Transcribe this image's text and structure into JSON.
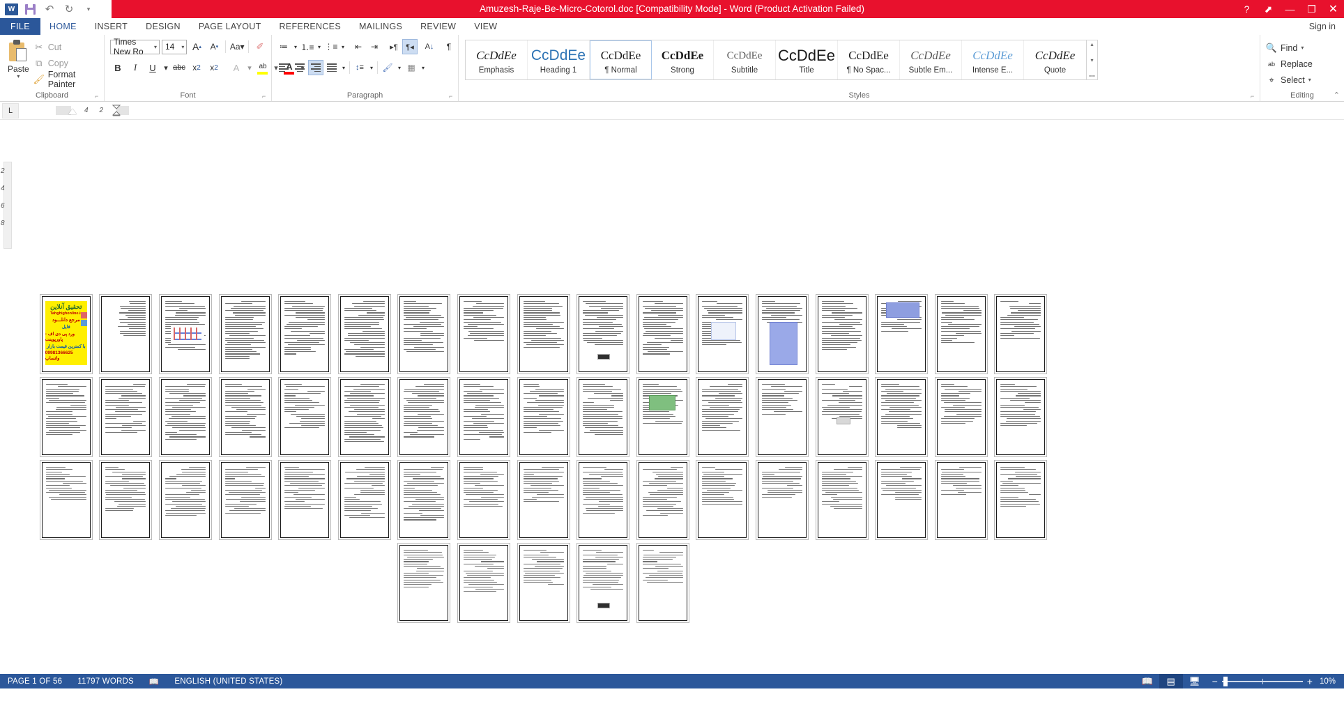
{
  "titlebar": {
    "document_title": "Amuzesh-Raje-Be-Micro-Cotorol.doc [Compatibility Mode]  -  Word (Product Activation Failed)",
    "quick_access": [
      {
        "name": "word-logo",
        "label": "W"
      },
      {
        "name": "save-icon",
        "label": ""
      },
      {
        "name": "undo-icon",
        "label": "↶"
      },
      {
        "name": "redo-icon",
        "label": "↻"
      },
      {
        "name": "customize-qat-icon",
        "label": "▾"
      }
    ],
    "window_buttons": [
      {
        "name": "help-button",
        "label": "?"
      },
      {
        "name": "ribbon-display-options-button",
        "label": "⬈"
      },
      {
        "name": "minimize-button",
        "label": "—"
      },
      {
        "name": "restore-button",
        "label": "❐"
      },
      {
        "name": "close-button",
        "label": "✕"
      }
    ]
  },
  "tabs": {
    "file": "FILE",
    "items": [
      "HOME",
      "INSERT",
      "DESIGN",
      "PAGE LAYOUT",
      "REFERENCES",
      "MAILINGS",
      "REVIEW",
      "VIEW"
    ],
    "active": "HOME",
    "signin": "Sign in"
  },
  "ribbon": {
    "groups": [
      {
        "label": "Clipboard"
      },
      {
        "label": "Font"
      },
      {
        "label": "Paragraph"
      },
      {
        "label": "Styles"
      },
      {
        "label": "Editing"
      }
    ],
    "clipboard": {
      "paste_label": "Paste",
      "cut_label": "Cut",
      "copy_label": "Copy",
      "format_painter_label": "Format Painter"
    },
    "font": {
      "font_name": "Times New Ro",
      "font_size": "14",
      "grow_font": "A",
      "shrink_font": "A",
      "change_case": "Aa",
      "clear_formatting": "✐",
      "bold": "B",
      "italic": "I",
      "underline": "U",
      "strikethrough": "abc",
      "subscript": "x₂",
      "superscript": "x²",
      "text_effects": "A",
      "highlight": "ab",
      "font_color": "A",
      "highlight_color": "#ffff00",
      "font_color_value": "#ff0000"
    },
    "paragraph": {
      "bullets": "≔",
      "numbering": "⅓",
      "multilevel": "⅀",
      "decrease_indent": "⇤",
      "increase_indent": "⇥",
      "ltr": "▸¶",
      "rtl": "¶◂",
      "sort": "A↓",
      "show_marks": "¶",
      "align_left": "≡",
      "align_center": "≡",
      "align_right": "≡",
      "justify": "≡",
      "line_spacing": "↕≡",
      "shading": "▧",
      "borders": "▦"
    },
    "styles": [
      {
        "preview": "CcDdEe",
        "name": "Emphasis",
        "style": "italic-serif"
      },
      {
        "preview": "CcDdEe",
        "name": "Heading 1",
        "style": "heading1"
      },
      {
        "preview": "CcDdEe",
        "name": "¶ Normal",
        "style": "normal",
        "selected": true
      },
      {
        "preview": "CcDdEe",
        "name": "Strong",
        "style": "strong"
      },
      {
        "preview": "CcDdEe",
        "name": "Subtitle",
        "style": "subtitle"
      },
      {
        "preview": "CcDdEe",
        "name": "Title",
        "style": "title"
      },
      {
        "preview": "CcDdEe",
        "name": "¶ No Spac...",
        "style": "nospacing"
      },
      {
        "preview": "CcDdEe",
        "name": "Subtle Em...",
        "style": "subtle-em"
      },
      {
        "preview": "CcDdEe",
        "name": "Intense E...",
        "style": "intense-em"
      },
      {
        "preview": "CcDdEe",
        "name": "Quote",
        "style": "quote"
      }
    ],
    "editing": {
      "find_label": "Find",
      "replace_label": "Replace",
      "select_label": "Select"
    }
  },
  "ruler": {
    "tab_stop": "L",
    "marks": [
      "4",
      "2"
    ]
  },
  "statusbar": {
    "page_info": "PAGE 1 OF 56",
    "word_count": "11797 WORDS",
    "proofing_icon": "proofing-errors-icon",
    "language": "ENGLISH (UNITED STATES)",
    "views": [
      {
        "name": "read-mode-view-button",
        "glyph": "▤",
        "active": false
      },
      {
        "name": "print-layout-view-button",
        "glyph": "▤",
        "active": true
      },
      {
        "name": "web-layout-view-button",
        "glyph": "▤",
        "active": false
      }
    ],
    "zoom_out": "−",
    "zoom_in": "+",
    "zoom_level": "10%"
  },
  "document": {
    "total_pages": 56,
    "rows": [
      [
        {
          "type": "cover"
        },
        {
          "type": "text",
          "lines": 16,
          "indent": true
        },
        {
          "type": "text-figure",
          "lines": 22,
          "figure": "circuit"
        },
        {
          "type": "text",
          "lines": 26
        },
        {
          "type": "text",
          "lines": 24
        },
        {
          "type": "text",
          "lines": 25
        },
        {
          "type": "text",
          "lines": 23
        },
        {
          "type": "text",
          "lines": 18
        },
        {
          "type": "text",
          "lines": 21
        },
        {
          "type": "text-photo",
          "lines": 20,
          "figure": "photo-dark"
        },
        {
          "type": "text",
          "lines": 24
        },
        {
          "type": "text-swirl",
          "lines": 20,
          "figure": "swirl"
        },
        {
          "type": "text-chart",
          "lines": 10,
          "figure": "chartblue"
        },
        {
          "type": "text",
          "lines": 22
        },
        {
          "type": "text-table",
          "lines": 14,
          "figure": "tblblue"
        },
        {
          "type": "text",
          "lines": 19
        },
        {
          "type": "text",
          "lines": 17
        }
      ],
      [
        {
          "type": "text",
          "lines": 23
        },
        {
          "type": "text",
          "lines": 22
        },
        {
          "type": "text",
          "lines": 25
        },
        {
          "type": "text",
          "lines": 24
        },
        {
          "type": "text",
          "lines": 20
        },
        {
          "type": "text",
          "lines": 26
        },
        {
          "type": "text",
          "lines": 24
        },
        {
          "type": "text",
          "lines": 25
        },
        {
          "type": "text",
          "lines": 22
        },
        {
          "type": "text",
          "lines": 23
        },
        {
          "type": "text-green",
          "lines": 18,
          "figure": "green"
        },
        {
          "type": "text",
          "lines": 21
        },
        {
          "type": "text",
          "lines": 14
        },
        {
          "type": "text-gray",
          "lines": 16,
          "figure": "gray"
        },
        {
          "type": "text",
          "lines": 20
        },
        {
          "type": "text",
          "lines": 18
        },
        {
          "type": "text",
          "lines": 19
        }
      ],
      [
        {
          "type": "text",
          "lines": 15
        },
        {
          "type": "text",
          "lines": 20
        },
        {
          "type": "text",
          "lines": 22
        },
        {
          "type": "text",
          "lines": 21
        },
        {
          "type": "text",
          "lines": 19
        },
        {
          "type": "text",
          "lines": 23
        },
        {
          "type": "text",
          "lines": 24
        },
        {
          "type": "text",
          "lines": 18
        },
        {
          "type": "text",
          "lines": 16
        },
        {
          "type": "text",
          "lines": 21
        },
        {
          "type": "text",
          "lines": 22
        },
        {
          "type": "text",
          "lines": 17
        },
        {
          "type": "text",
          "lines": 14
        },
        {
          "type": "text",
          "lines": 19
        },
        {
          "type": "text",
          "lines": 15
        },
        {
          "type": "text",
          "lines": 13
        },
        {
          "type": "text",
          "lines": 18
        }
      ],
      [
        {
          "type": "spacer"
        },
        {
          "type": "spacer"
        },
        {
          "type": "spacer"
        },
        {
          "type": "spacer"
        },
        {
          "type": "spacer"
        },
        {
          "type": "spacer"
        },
        {
          "type": "text",
          "lines": 17
        },
        {
          "type": "text",
          "lines": 19
        },
        {
          "type": "text",
          "lines": 16
        },
        {
          "type": "text-photo",
          "lines": 18,
          "figure": "photo-dark"
        },
        {
          "type": "text",
          "lines": 15
        }
      ]
    ],
    "cover": {
      "title": "تحقیق آنلاین",
      "site": "Tahghighonline.ir",
      "line1": "مرجع دانلـــود",
      "line2": "فایل",
      "line3": "ورد پی دی اف - پاورپوینت",
      "line4": "با کمترین قیمت بازار",
      "line5": "09981366625 واتساپ"
    }
  }
}
